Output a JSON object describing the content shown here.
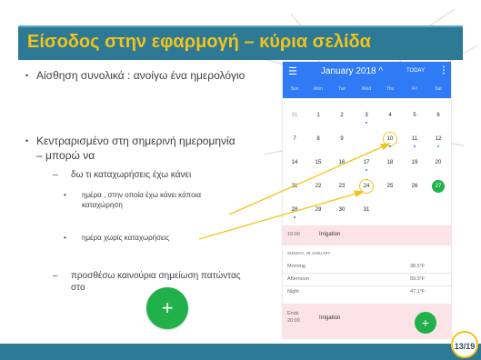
{
  "slide": {
    "title": "Είσοδος στην εφαρμογή – κύρια σελίδα",
    "page_number": "13/19",
    "bullets": [
      {
        "text": "Αίσθηση συνολικά : ανοίγω ένα ημερολόγιο"
      },
      {
        "text": "Κεντραρισμένο στη σημερινή ημερομηνία – μπορώ να"
      }
    ],
    "sub_bullets": [
      "δω τι καταχωρήσεις έχω κάνει",
      "προσθέσω καινούρια σημείωση πατώντας στο"
    ],
    "subsub_bullets": [
      "ημέρα , στην οποία έχω κάνει κάποια καταχώρηση",
      "ημέρα χωρίς καταχωρήσεις"
    ],
    "fab_symbol": "+"
  },
  "phone": {
    "menu_icon": "menu-icon",
    "month_title": "January 2018 ^",
    "today_label": "TODAY",
    "more_icon": "more-icon",
    "weekdays": [
      "Sun",
      "Mon",
      "Tue",
      "Wed",
      "Thu",
      "Fri",
      "Sat"
    ],
    "weeks": [
      [
        "31",
        "1",
        "2",
        "3",
        "4",
        "5",
        "6"
      ],
      [
        "7",
        "8",
        "9",
        "10",
        "11",
        "12",
        "13"
      ],
      [
        "14",
        "15",
        "16",
        "17",
        "18",
        "19",
        "20"
      ],
      [
        "21",
        "22",
        "23",
        "24",
        "25",
        "26",
        "27"
      ],
      [
        "28",
        "29",
        "30",
        "31",
        "",
        "",
        ""
      ]
    ],
    "selected_day": "10",
    "empty_day": "24",
    "today_day": "27",
    "event1": {
      "time": "19:00",
      "name": "Irrigation"
    },
    "date_header": "SUNDAY, 28 JANUARY",
    "weather": [
      {
        "period": "Morning",
        "value": "38.5°F"
      },
      {
        "period": "Afternoon",
        "value": "59.9°F"
      },
      {
        "period": "Night",
        "value": "47.1°F"
      }
    ],
    "event2": {
      "time_label": "Ends",
      "time": "20:00",
      "name": "Irrigation"
    },
    "fab_symbol": "+"
  },
  "colors": {
    "title_bar": "#2e7a96",
    "title_text": "#f3c319",
    "app_blue": "#2f7bf5",
    "fab_green": "#21b14a",
    "highlight_ring": "#f3c319"
  }
}
